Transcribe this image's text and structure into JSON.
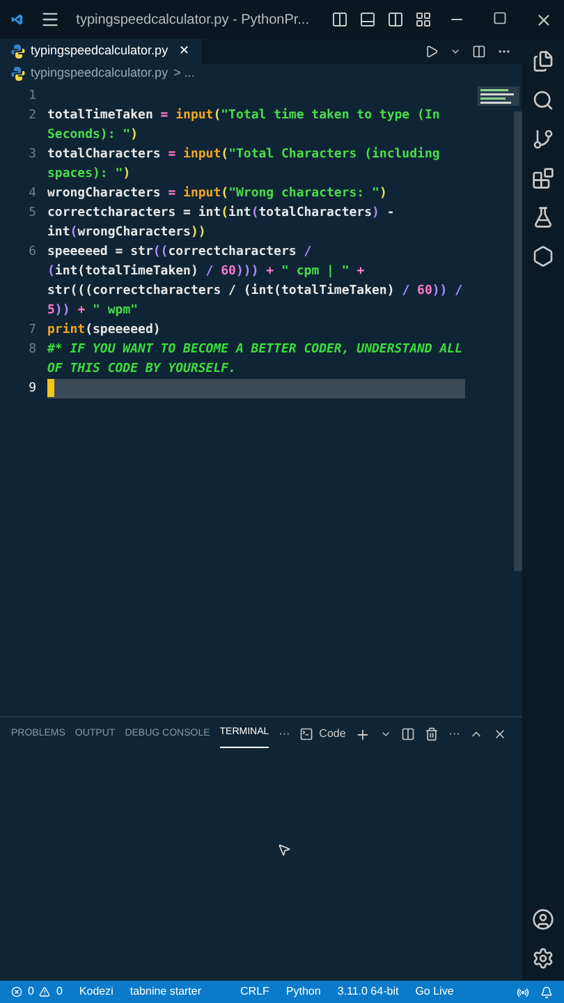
{
  "title_bar": {
    "title": "typingspeedcalculator.py - PythonPr..."
  },
  "tabs": [
    {
      "label": "typingspeedcalculator.py",
      "close": "✕",
      "selected": true
    }
  ],
  "breadcrumb": {
    "file": "typingspeedcalculator.py",
    "rest": "> ..."
  },
  "code": [
    {
      "number": "1",
      "current": false
    },
    {
      "number": "2",
      "current": false,
      "segments": [
        {
          "text": "totalTimeTaken ",
          "kind": "var"
        },
        {
          "text": "= ",
          "kind": "op"
        },
        {
          "text": "input",
          "kind": "func"
        },
        {
          "text": "(",
          "kind": "bracket"
        },
        {
          "text": "\"Total time taken to type (In Seconds): \"",
          "kind": "string"
        },
        {
          "text": ")",
          "kind": "bracket"
        }
      ]
    },
    {
      "number": "3",
      "current": false,
      "segments": [
        {
          "text": "totalCharacters ",
          "kind": "var"
        },
        {
          "text": "= ",
          "kind": "op"
        },
        {
          "text": "input",
          "kind": "func"
        },
        {
          "text": "(",
          "kind": "bracket"
        },
        {
          "text": "\"Total Characters (including spaces): \"",
          "kind": "string"
        },
        {
          "text": ")",
          "kind": "bracket"
        }
      ]
    },
    {
      "number": "4",
      "current": false,
      "segments": [
        {
          "text": "wrongCharacters ",
          "kind": "var"
        },
        {
          "text": "= ",
          "kind": "op"
        },
        {
          "text": "input",
          "kind": "func"
        },
        {
          "text": "(",
          "kind": "bracket"
        },
        {
          "text": "\"Wrong characters: \"",
          "kind": "string"
        },
        {
          "text": ")",
          "kind": "bracket"
        }
      ]
    },
    {
      "number": "5",
      "current": false,
      "segments": [
        {
          "text": "correctcharacters = int",
          "kind": "var"
        },
        {
          "text": "(",
          "kind": "bracket"
        },
        {
          "text": "int",
          "kind": "var"
        },
        {
          "text": "(",
          "kind": "paren"
        },
        {
          "text": "totalCharacters",
          "kind": "var"
        },
        {
          "text": ")",
          "kind": "paren"
        },
        {
          "text": " - int",
          "kind": "var"
        },
        {
          "text": "(",
          "kind": "paren"
        },
        {
          "text": "wrongCharacters",
          "kind": "var"
        },
        {
          "text": "))",
          "kind": "bracket"
        }
      ]
    },
    {
      "number": "6",
      "current": false,
      "segments": [
        {
          "text": "speeeeed = str",
          "kind": "var"
        },
        {
          "text": "((",
          "kind": "paren"
        },
        {
          "text": "correctcharacters ",
          "kind": "var"
        },
        {
          "text": "/ (",
          "kind": "paren"
        },
        {
          "text": "int(totalTimeTaken) ",
          "kind": "var"
        },
        {
          "text": "/ ",
          "kind": "paren"
        },
        {
          "text": "60",
          "kind": "number"
        },
        {
          "text": "))) ",
          "kind": "paren"
        },
        {
          "text": "+ ",
          "kind": "op"
        },
        {
          "text": "\" cpm | \" ",
          "kind": "string"
        },
        {
          "text": "+ ",
          "kind": "op"
        },
        {
          "text": "str(((",
          "kind": "var"
        },
        {
          "text": "correctcharacters / (int(totalTimeTaken) ",
          "kind": "var"
        },
        {
          "text": "/ ",
          "kind": "paren"
        },
        {
          "text": "60",
          "kind": "number"
        },
        {
          "text": ")) / ",
          "kind": "paren"
        },
        {
          "text": "5",
          "kind": "number"
        },
        {
          "text": ")) ",
          "kind": "paren"
        },
        {
          "text": "+ ",
          "kind": "op"
        },
        {
          "text": "\" wpm\"",
          "kind": "string"
        }
      ]
    },
    {
      "number": "7",
      "current": false,
      "segments": [
        {
          "text": "print",
          "kind": "func"
        },
        {
          "text": "(speeeeed)",
          "kind": "var"
        }
      ]
    },
    {
      "number": "8",
      "current": false,
      "segments": [
        {
          "text": "#* IF YOU WANT TO BECOME A BETTER CODER, UNDERSTAND ALL OF THIS CODE BY YOURSELF.",
          "kind": "comment"
        }
      ]
    },
    {
      "number": "9",
      "current": true
    }
  ],
  "panel": {
    "tabs": [
      {
        "label": "PROBLEMS",
        "selected": false
      },
      {
        "label": "OUTPUT",
        "selected": false
      },
      {
        "label": "DEBUG CONSOLE",
        "selected": false
      },
      {
        "label": "TERMINAL",
        "selected": true
      }
    ],
    "more": "···",
    "terminal": "Code",
    "more2": "···"
  },
  "status_bar": {
    "errors": "0",
    "warnings": "0",
    "items": [
      "Kodezi",
      "tabnine starter",
      "CRLF",
      "Python",
      "3.11.0 64-bit",
      "Go Live"
    ]
  }
}
